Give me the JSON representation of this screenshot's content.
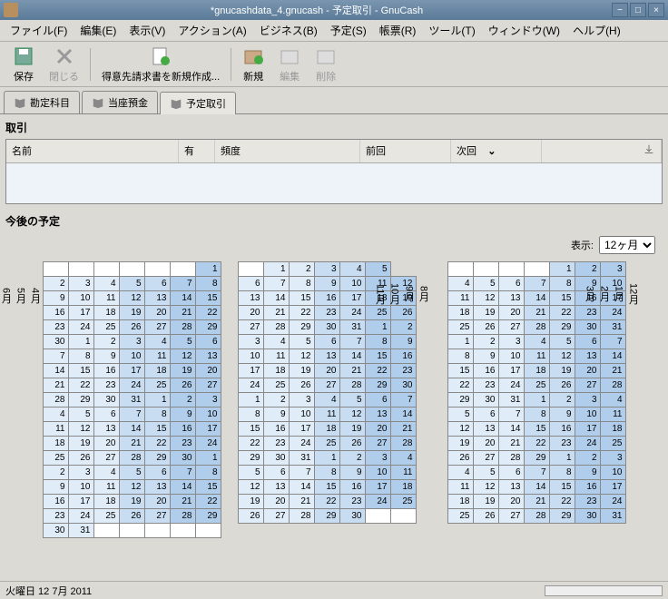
{
  "window_title": "*gnucashdata_4.gnucash - 予定取引 - GnuCash",
  "menu": [
    "ファイル(F)",
    "編集(E)",
    "表示(V)",
    "アクション(A)",
    "ビジネス(B)",
    "予定(S)",
    "帳票(R)",
    "ツール(T)",
    "ウィンドウ(W)",
    "ヘルプ(H)"
  ],
  "toolbar": {
    "save": "保存",
    "close": "閉じる",
    "newbill": "得意先請求書を新規作成...",
    "new": "新規",
    "edit": "編集",
    "delete": "削除"
  },
  "tabs": [
    "勘定科目",
    "当座預金",
    "予定取引"
  ],
  "section1": "取引",
  "cols": {
    "name": "名前",
    "enabled": "有",
    "freq": "頻度",
    "last": "前回",
    "next": "次回"
  },
  "section2": "今後の予定",
  "view_label": "表示:",
  "view_value": "12ヶ月",
  "status": "火曜日 12 7月 2011",
  "months_left": [
    "4月",
    "5月",
    "6月",
    "7月"
  ],
  "months_mid": [
    "8月",
    "9月",
    "10月",
    "11月"
  ],
  "months_right": [
    "12月",
    "1月",
    "2月",
    "3月"
  ],
  "cal_left": [
    [
      null,
      null,
      null,
      null,
      null,
      null,
      1
    ],
    [
      2,
      3,
      4,
      5,
      6,
      7,
      8
    ],
    [
      9,
      10,
      11,
      12,
      13,
      14,
      15
    ],
    [
      16,
      17,
      18,
      19,
      20,
      21,
      22
    ],
    [
      23,
      24,
      25,
      26,
      27,
      28,
      29
    ],
    [
      30,
      1,
      2,
      3,
      4,
      5,
      6
    ],
    [
      7,
      8,
      9,
      10,
      11,
      12,
      13
    ],
    [
      14,
      15,
      16,
      17,
      18,
      19,
      20
    ],
    [
      21,
      22,
      23,
      24,
      25,
      26,
      27
    ],
    [
      28,
      29,
      30,
      31,
      1,
      2,
      3
    ],
    [
      4,
      5,
      6,
      7,
      8,
      9,
      10
    ],
    [
      11,
      12,
      13,
      14,
      15,
      16,
      17
    ],
    [
      18,
      19,
      20,
      21,
      22,
      23,
      24
    ],
    [
      25,
      26,
      27,
      28,
      29,
      30,
      1
    ],
    [
      2,
      3,
      4,
      5,
      6,
      7,
      8
    ],
    [
      9,
      10,
      11,
      12,
      13,
      14,
      15
    ],
    [
      16,
      17,
      18,
      19,
      20,
      21,
      22
    ],
    [
      23,
      24,
      25,
      26,
      27,
      28,
      29
    ],
    [
      30,
      31,
      null,
      null,
      null,
      null,
      null
    ]
  ],
  "cal_mid": [
    [
      null,
      1,
      2,
      3,
      4,
      5
    ],
    [
      6,
      7,
      8,
      9,
      10,
      11,
      12
    ],
    [
      13,
      14,
      15,
      16,
      17,
      18,
      19
    ],
    [
      20,
      21,
      22,
      23,
      24,
      25,
      26
    ],
    [
      27,
      28,
      29,
      30,
      31,
      1,
      2
    ],
    [
      3,
      4,
      5,
      6,
      7,
      8,
      9
    ],
    [
      10,
      11,
      12,
      13,
      14,
      15,
      16
    ],
    [
      17,
      18,
      19,
      20,
      21,
      22,
      23
    ],
    [
      24,
      25,
      26,
      27,
      28,
      29,
      30
    ],
    [
      1,
      2,
      3,
      4,
      5,
      6,
      7
    ],
    [
      8,
      9,
      10,
      11,
      12,
      13,
      14
    ],
    [
      15,
      16,
      17,
      18,
      19,
      20,
      21
    ],
    [
      22,
      23,
      24,
      25,
      26,
      27,
      28
    ],
    [
      29,
      30,
      31,
      1,
      2,
      3,
      4
    ],
    [
      5,
      6,
      7,
      8,
      9,
      10,
      11
    ],
    [
      12,
      13,
      14,
      15,
      16,
      17,
      18
    ],
    [
      19,
      20,
      21,
      22,
      23,
      24,
      25
    ],
    [
      26,
      27,
      28,
      29,
      30,
      null,
      null
    ]
  ],
  "cal_right": [
    [
      null,
      null,
      null,
      null,
      1,
      2,
      3
    ],
    [
      4,
      5,
      6,
      7,
      8,
      9,
      10
    ],
    [
      11,
      12,
      13,
      14,
      15,
      16,
      17
    ],
    [
      18,
      19,
      20,
      21,
      22,
      23,
      24
    ],
    [
      25,
      26,
      27,
      28,
      29,
      30,
      31
    ],
    [
      1,
      2,
      3,
      4,
      5,
      6,
      7
    ],
    [
      8,
      9,
      10,
      11,
      12,
      13,
      14
    ],
    [
      15,
      16,
      17,
      18,
      19,
      20,
      21
    ],
    [
      22,
      23,
      24,
      25,
      26,
      27,
      28
    ],
    [
      29,
      30,
      31,
      1,
      2,
      3,
      4
    ],
    [
      5,
      6,
      7,
      8,
      9,
      10,
      11
    ],
    [
      12,
      13,
      14,
      15,
      16,
      17,
      18
    ],
    [
      19,
      20,
      21,
      22,
      23,
      24,
      25
    ],
    [
      26,
      27,
      28,
      29,
      1,
      2,
      3
    ],
    [
      4,
      5,
      6,
      7,
      8,
      9,
      10
    ],
    [
      11,
      12,
      13,
      14,
      15,
      16,
      17
    ],
    [
      18,
      19,
      20,
      21,
      22,
      23,
      24
    ],
    [
      25,
      26,
      27,
      28,
      29,
      30,
      31
    ]
  ]
}
